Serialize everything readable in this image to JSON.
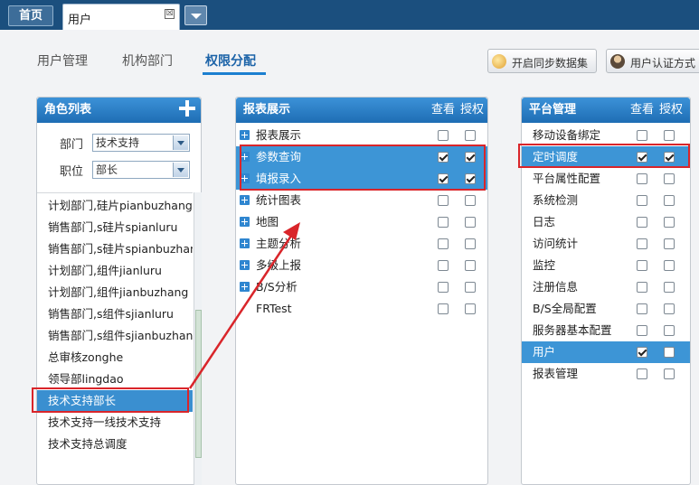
{
  "tabs": {
    "home": "首页",
    "active": "用户",
    "close_glyph": "☒"
  },
  "nav": {
    "user_mgmt": "用户管理",
    "org": "机构部门",
    "permission": "权限分配"
  },
  "toolbar": {
    "sync": "开启同步数据集",
    "auth": "用户认证方式"
  },
  "role_panel": {
    "title": "角色列表",
    "dept_label": "部门",
    "dept_value": "技术支持",
    "post_label": "职位",
    "post_value": "部长",
    "roles": [
      "计划部门,硅片pianbuzhang",
      "销售部门,s硅片spianluru",
      "销售部门,s硅片spianbuzhang",
      "计划部门,组件jianluru",
      "计划部门,组件jianbuzhang",
      "销售部门,s组件sjianluru",
      "销售部门,s组件sjianbuzhang",
      "总审核zonghe",
      "领导部lingdao",
      "技术支持部长",
      "技术支持一线技术支持",
      "技术支持总调度"
    ],
    "selected_index": 9
  },
  "report_panel": {
    "title": "报表展示",
    "col_view": "查看",
    "col_grant": "授权",
    "rows": [
      {
        "label": "报表展示",
        "expand": true,
        "view": false,
        "grant": false,
        "highlight": false
      },
      {
        "label": "参数查询",
        "expand": true,
        "view": true,
        "grant": true,
        "highlight": true
      },
      {
        "label": "填报录入",
        "expand": true,
        "view": true,
        "grant": true,
        "highlight": true
      },
      {
        "label": "统计图表",
        "expand": true,
        "view": false,
        "grant": false,
        "highlight": false
      },
      {
        "label": "地图",
        "expand": true,
        "view": false,
        "grant": false,
        "highlight": false
      },
      {
        "label": "主题分析",
        "expand": true,
        "view": false,
        "grant": false,
        "highlight": false
      },
      {
        "label": "多级上报",
        "expand": true,
        "view": false,
        "grant": false,
        "highlight": false
      },
      {
        "label": "B/S分析",
        "expand": true,
        "view": false,
        "grant": false,
        "highlight": false
      },
      {
        "label": "FRTest",
        "expand": false,
        "view": false,
        "grant": false,
        "highlight": false
      }
    ]
  },
  "platform_panel": {
    "title": "平台管理",
    "col_view": "查看",
    "col_grant": "授权",
    "rows": [
      {
        "label": "移动设备绑定",
        "view": false,
        "grant": false,
        "highlight": false
      },
      {
        "label": "定时调度",
        "view": true,
        "grant": true,
        "highlight": true
      },
      {
        "label": "平台属性配置",
        "view": false,
        "grant": false,
        "highlight": false
      },
      {
        "label": "系统检测",
        "view": false,
        "grant": false,
        "highlight": false
      },
      {
        "label": "日志",
        "view": false,
        "grant": false,
        "highlight": false
      },
      {
        "label": "访问统计",
        "view": false,
        "grant": false,
        "highlight": false
      },
      {
        "label": "监控",
        "view": false,
        "grant": false,
        "highlight": false
      },
      {
        "label": "注册信息",
        "view": false,
        "grant": false,
        "highlight": false
      },
      {
        "label": "B/S全局配置",
        "view": false,
        "grant": false,
        "highlight": false
      },
      {
        "label": "服务器基本配置",
        "view": false,
        "grant": false,
        "highlight": false
      },
      {
        "label": "用户",
        "view": true,
        "grant": false,
        "highlight": true
      },
      {
        "label": "报表管理",
        "view": false,
        "grant": false,
        "highlight": false
      }
    ]
  },
  "colors": {
    "header_bar": "#1b4f7e",
    "panel_header": "#2a7cc4",
    "highlight": "#3d95d6",
    "annotation": "#d9252a"
  }
}
